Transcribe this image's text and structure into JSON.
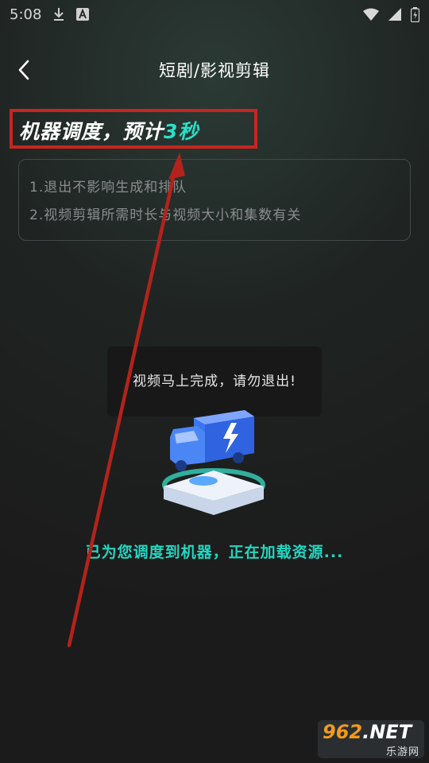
{
  "status_bar": {
    "time": "5:08",
    "icons": [
      "download-icon",
      "font-icon",
      "wifi-icon",
      "battery-icon"
    ]
  },
  "header": {
    "back_icon": "chevron-left-icon",
    "title": "短剧/影视剪辑"
  },
  "schedule": {
    "prefix": "机器调度，预计",
    "time_value": "3秒",
    "highlight_color": "#29e0c9"
  },
  "info_card": {
    "lines": [
      "1.退出不影响生成和排队",
      "2.视频剪辑所需时长与视频大小和集数有关"
    ]
  },
  "toast": {
    "message": "视频马上完成，请勿退出!"
  },
  "illustration": {
    "icon": "truck-icon"
  },
  "loading": {
    "text": "已为您调度到机器，正在加载资源...",
    "color": "#23d6c1"
  },
  "annotation": {
    "box_color": "#c8251f",
    "arrow_color": "#b3231b"
  },
  "watermark": {
    "number": "962",
    "suffix": ".NET",
    "site_name": "乐游网"
  }
}
